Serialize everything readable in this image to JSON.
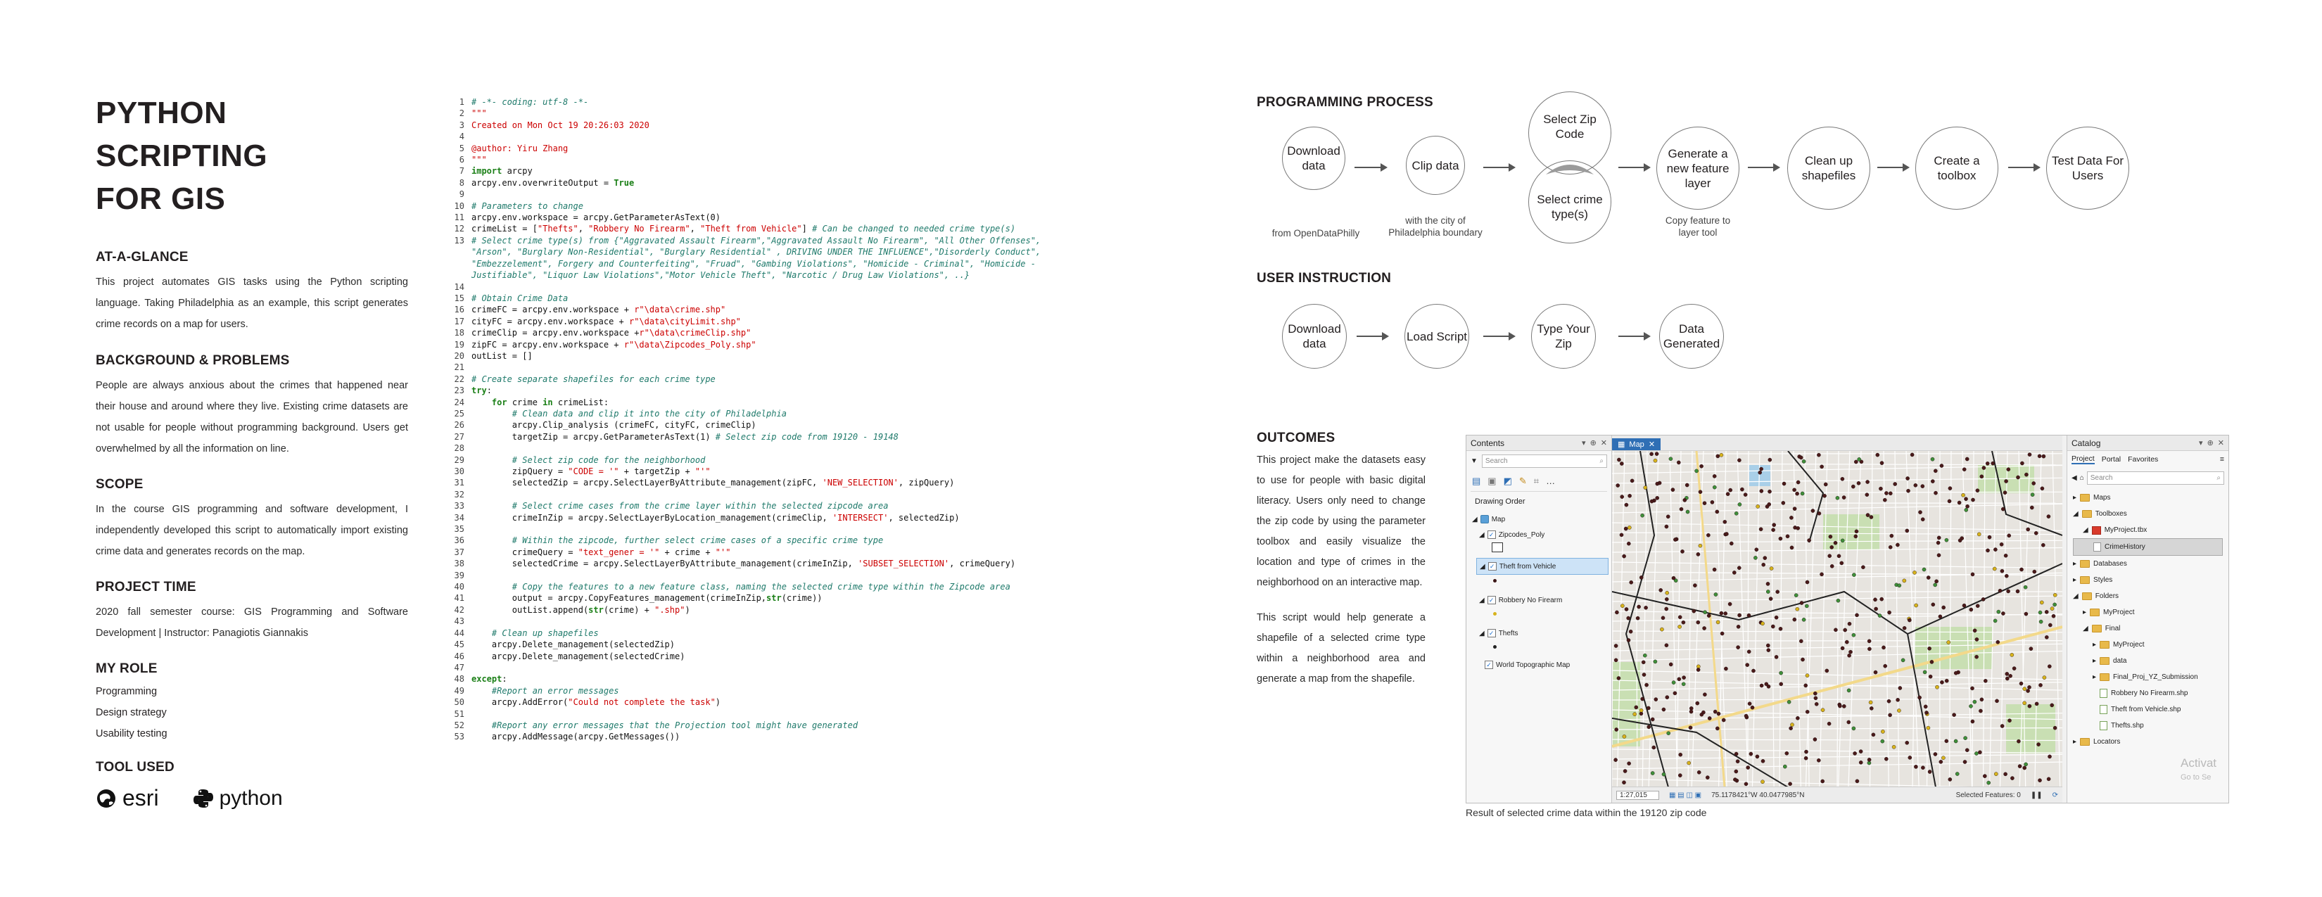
{
  "left": {
    "title": [
      "PYTHON",
      "SCRIPTING",
      "FOR GIS"
    ],
    "sections": [
      {
        "heading": "AT-A-GLANCE",
        "body": "This project automates GIS tasks using the Python scripting language. Taking Philadelphia as an example, this script generates crime records on a map for users."
      },
      {
        "heading": "BACKGROUND & PROBLEMS",
        "body": "People are always anxious about the crimes that happened near their house and around where they live. Existing crime datasets are not usable for people without programming background. Users get overwhelmed by all the information on line."
      },
      {
        "heading": "SCOPE",
        "body": "In the course GIS programming and software development, I independently developed this script to automatically import existing crime data and generates records on the map."
      },
      {
        "heading": "PROJECT TIME",
        "body": "2020 fall semester course: GIS Programming and Software Development | Instructor: Panagiotis Giannakis"
      }
    ],
    "role_heading": "MY ROLE",
    "roles": [
      "Programming",
      "Design strategy",
      "Usability testing"
    ],
    "tools_heading": "TOOL USED",
    "tools": [
      "esri",
      "python"
    ]
  },
  "code": [
    {
      "n": "1",
      "segs": [
        [
          "c",
          "# -*- coding: utf-8 -*-"
        ]
      ]
    },
    {
      "n": "2",
      "segs": [
        [
          "s",
          "\"\"\""
        ]
      ]
    },
    {
      "n": "3",
      "segs": [
        [
          "s",
          "Created on Mon Oct 19 20:26:03 2020"
        ]
      ]
    },
    {
      "n": "4",
      "segs": []
    },
    {
      "n": "5",
      "segs": [
        [
          "s",
          "@author: Yiru Zhang"
        ]
      ]
    },
    {
      "n": "6",
      "segs": [
        [
          "s",
          "\"\"\""
        ]
      ]
    },
    {
      "n": "7",
      "segs": [
        [
          "k",
          "import"
        ],
        [
          "p",
          " arcpy"
        ]
      ]
    },
    {
      "n": "8",
      "segs": [
        [
          "p",
          "arcpy.env.overwriteOutput = "
        ],
        [
          "k",
          "True"
        ]
      ]
    },
    {
      "n": "9",
      "segs": []
    },
    {
      "n": "10",
      "segs": [
        [
          "c",
          "# Parameters to change"
        ]
      ]
    },
    {
      "n": "11",
      "segs": [
        [
          "p",
          "arcpy.env.workspace = arcpy.GetParameterAsText(0)"
        ]
      ]
    },
    {
      "n": "12",
      "segs": [
        [
          "p",
          "crimeList = ["
        ],
        [
          "s",
          "\"Thefts\""
        ],
        [
          "p",
          ", "
        ],
        [
          "s",
          "\"Robbery No Firearm\""
        ],
        [
          "p",
          ", "
        ],
        [
          "s",
          "\"Theft from Vehicle\""
        ],
        [
          "p",
          "] "
        ],
        [
          "c",
          "# Can be changed to needed crime type(s)"
        ]
      ]
    },
    {
      "n": "13",
      "segs": [
        [
          "c",
          "# Select crime type(s) from {\"Aggravated Assault Firearm\",\"Aggravated Assault No Firearm\", \"All Other Offenses\", \"Arson\", \"Burglary Non-Residential\", \"Burglary Residential\" , DRIVING UNDER THE INFLUENCE\",\"Disorderly Conduct\", \"Embezzelement\", Forgery and Counterfeiting\", \"Fruad\", \"Gambing Violations\", \"Homicide - Criminal\", \"Homicide - Justifiable\", \"Liquor Law Violations\",\"Motor Vehicle Theft\", \"Narcotic / Drug Law Violations\", ..}"
        ]
      ]
    },
    {
      "n": "14",
      "segs": []
    },
    {
      "n": "15",
      "segs": [
        [
          "c",
          "# Obtain Crime Data"
        ]
      ]
    },
    {
      "n": "16",
      "segs": [
        [
          "p",
          "crimeFC = arcpy.env.workspace + "
        ],
        [
          "s",
          "r\"\\data\\crime.shp\""
        ]
      ]
    },
    {
      "n": "17",
      "segs": [
        [
          "p",
          "cityFC = arcpy.env.workspace + "
        ],
        [
          "s",
          "r\"\\data\\cityLimit.shp\""
        ]
      ]
    },
    {
      "n": "18",
      "segs": [
        [
          "p",
          "crimeClip = arcpy.env.workspace +"
        ],
        [
          "s",
          "r\"\\data\\crimeClip.shp\""
        ]
      ]
    },
    {
      "n": "19",
      "segs": [
        [
          "p",
          "zipFC = arcpy.env.workspace + "
        ],
        [
          "s",
          "r\"\\data\\Zipcodes_Poly.shp\""
        ]
      ]
    },
    {
      "n": "20",
      "segs": [
        [
          "p",
          "outList = []"
        ]
      ]
    },
    {
      "n": "21",
      "segs": []
    },
    {
      "n": "22",
      "segs": [
        [
          "c",
          "# Create separate shapefiles for each crime type"
        ]
      ]
    },
    {
      "n": "23",
      "segs": [
        [
          "k",
          "try"
        ],
        [
          "p",
          ":"
        ]
      ]
    },
    {
      "n": "24",
      "segs": [
        [
          "p",
          "    "
        ],
        [
          "k",
          "for"
        ],
        [
          "p",
          " crime "
        ],
        [
          "k",
          "in"
        ],
        [
          "p",
          " crimeList:"
        ]
      ]
    },
    {
      "n": "25",
      "segs": [
        [
          "p",
          "        "
        ],
        [
          "c",
          "# Clean data and clip it into the city of Philadelphia"
        ]
      ]
    },
    {
      "n": "26",
      "segs": [
        [
          "p",
          "        arcpy.Clip_analysis (crimeFC, cityFC, crimeClip)"
        ]
      ]
    },
    {
      "n": "27",
      "segs": [
        [
          "p",
          "        targetZip = arcpy.GetParameterAsText(1) "
        ],
        [
          "c",
          "# Select zip code from 19120 - 19148"
        ]
      ]
    },
    {
      "n": "28",
      "segs": []
    },
    {
      "n": "29",
      "segs": [
        [
          "p",
          "        "
        ],
        [
          "c",
          "# Select zip code for the neighborhood"
        ]
      ]
    },
    {
      "n": "30",
      "segs": [
        [
          "p",
          "        zipQuery = "
        ],
        [
          "s",
          "\"CODE = '\""
        ],
        [
          "p",
          " + targetZip + "
        ],
        [
          "s",
          "\"'\""
        ]
      ]
    },
    {
      "n": "31",
      "segs": [
        [
          "p",
          "        selectedZip = arcpy.SelectLayerByAttribute_management(zipFC, "
        ],
        [
          "s",
          "'NEW_SELECTION'"
        ],
        [
          "p",
          ", zipQuery)"
        ]
      ]
    },
    {
      "n": "32",
      "segs": []
    },
    {
      "n": "33",
      "segs": [
        [
          "p",
          "        "
        ],
        [
          "c",
          "# Select crime cases from the crime layer within the selected zipcode area"
        ]
      ]
    },
    {
      "n": "34",
      "segs": [
        [
          "p",
          "        crimeInZip = arcpy.SelectLayerByLocation_management(crimeClip, "
        ],
        [
          "s",
          "'INTERSECT'"
        ],
        [
          "p",
          ", selectedZip)"
        ]
      ]
    },
    {
      "n": "35",
      "segs": []
    },
    {
      "n": "36",
      "segs": [
        [
          "p",
          "        "
        ],
        [
          "c",
          "# Within the zipcode, further select crime cases of a specific crime type"
        ]
      ]
    },
    {
      "n": "37",
      "segs": [
        [
          "p",
          "        crimeQuery = "
        ],
        [
          "s",
          "\"text_gener = '\""
        ],
        [
          "p",
          " + crime + "
        ],
        [
          "s",
          "\"'\""
        ]
      ]
    },
    {
      "n": "38",
      "segs": [
        [
          "p",
          "        selectedCrime = arcpy.SelectLayerByAttribute_management(crimeInZip, "
        ],
        [
          "s",
          "'SUBSET_SELECTION'"
        ],
        [
          "p",
          ", crimeQuery)"
        ]
      ]
    },
    {
      "n": "39",
      "segs": []
    },
    {
      "n": "40",
      "segs": [
        [
          "p",
          "        "
        ],
        [
          "c",
          "# Copy the features to a new feature class, naming the selected crime type within the Zipcode area"
        ]
      ]
    },
    {
      "n": "41",
      "segs": [
        [
          "p",
          "        output = arcpy.CopyFeatures_management(crimeInZip,"
        ],
        [
          "k",
          "str"
        ],
        [
          "p",
          "(crime))"
        ]
      ]
    },
    {
      "n": "42",
      "segs": [
        [
          "p",
          "        outList.append("
        ],
        [
          "k",
          "str"
        ],
        [
          "p",
          "(crime) + "
        ],
        [
          "s",
          "\".shp\""
        ],
        [
          "p",
          ")"
        ]
      ]
    },
    {
      "n": "43",
      "segs": []
    },
    {
      "n": "44",
      "segs": [
        [
          "p",
          "    "
        ],
        [
          "c",
          "# Clean up shapefiles"
        ]
      ]
    },
    {
      "n": "45",
      "segs": [
        [
          "p",
          "    arcpy.Delete_management(selectedZip)"
        ]
      ]
    },
    {
      "n": "46",
      "segs": [
        [
          "p",
          "    arcpy.Delete_management(selectedCrime)"
        ]
      ]
    },
    {
      "n": "47",
      "segs": []
    },
    {
      "n": "48",
      "segs": [
        [
          "k",
          "except"
        ],
        [
          "p",
          ":"
        ]
      ]
    },
    {
      "n": "49",
      "segs": [
        [
          "p",
          "    "
        ],
        [
          "c",
          "#Report an error messages"
        ]
      ]
    },
    {
      "n": "50",
      "segs": [
        [
          "p",
          "    arcpy.AddError("
        ],
        [
          "s",
          "\"Could not complete the task\""
        ],
        [
          "p",
          ")"
        ]
      ]
    },
    {
      "n": "51",
      "segs": []
    },
    {
      "n": "52",
      "segs": [
        [
          "p",
          "    "
        ],
        [
          "c",
          "#Report any error messages that the Projection tool might have generated"
        ]
      ]
    },
    {
      "n": "53",
      "segs": [
        [
          "p",
          "    arcpy.AddMessage(arcpy.GetMessages())"
        ]
      ]
    }
  ],
  "process": {
    "heading": "PROGRAMMING PROCESS",
    "steps": [
      "Download data",
      "Clip data",
      "Select Zip Code",
      "Select crime type(s)",
      "Generate a new feature layer",
      "Clean up shapefiles",
      "Create a toolbox",
      "Test Data For Users"
    ],
    "captions": [
      "from OpenDataPhilly",
      "with the city of Philadelphia boundary",
      "Copy feature to layer tool"
    ]
  },
  "instruction": {
    "heading": "USER INSTRUCTION",
    "steps": [
      "Download data",
      "Load Script",
      "Type Your Zip",
      "Data Generated"
    ]
  },
  "outcomes": {
    "heading": "OUTCOMES",
    "paragraphs": [
      "This project make the datasets easy to use for people with basic digital literacy. Users only need to change the zip code by using the parameter toolbox and easily visualize the location and type of crimes in the neighborhood on an interactive map.",
      "This script would help generate a shapefile of a selected crime type within a neighborhood area and generate a map from the shapefile."
    ],
    "caption": "Result of selected crime data within the 19120 zip code"
  },
  "gis": {
    "contents_title": "Contents",
    "contents_search": "Search",
    "drawing_order": "Drawing Order",
    "layers": [
      "Map",
      "Zipcodes_Poly",
      "Theft from Vehicle",
      "Robbery No Firearm",
      "Thefts",
      "World Topographic Map"
    ],
    "map_tab": "Map",
    "catalog_title": "Catalog",
    "catalog_tabs": [
      "Project",
      "Portal",
      "Favorites"
    ],
    "catalog_search": "Search",
    "catalog_items": [
      "Maps",
      "Toolboxes",
      "MyProject.tbx",
      "CrimeHistory",
      "Databases",
      "Styles",
      "Folders",
      "MyProject",
      "Final",
      "MyProject",
      "data",
      "Final_Proj_YZ_Submission",
      "Robbery No Firearm.shp",
      "Theft from Vehicle.shp",
      "Thefts.shp",
      "Locators"
    ],
    "scale": "1:27,015",
    "coords": "75.1178421°W 40.0477985°N",
    "selected": "Selected Features: 0",
    "watermark": "Activat",
    "watermark2": "Go to Se",
    "colors": {
      "point_dark": "#4a1a1a",
      "point_green": "#3f8f3a",
      "point_yellow": "#d7b31c",
      "park": "#c9dfb3",
      "water": "#a9cfe8",
      "selection": "#cde3f7"
    }
  }
}
